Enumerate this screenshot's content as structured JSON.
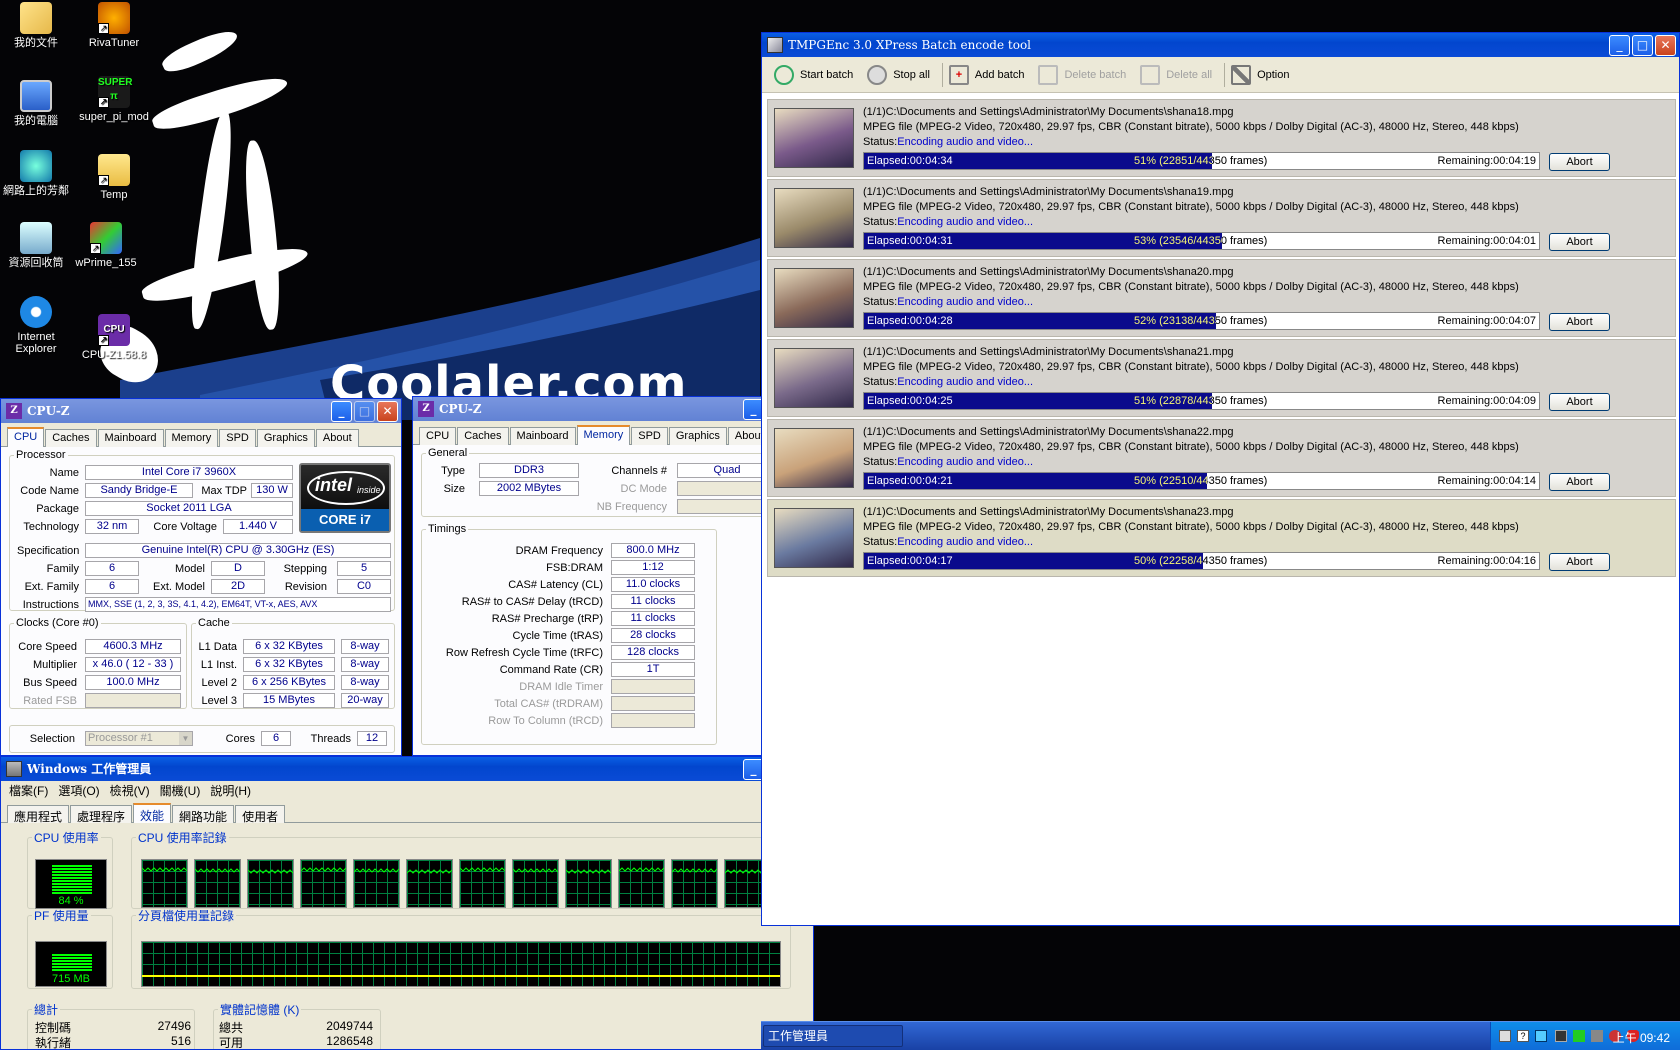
{
  "desktop": {
    "banner_text": "Coolaler.com",
    "icons": [
      {
        "label": "我的文件",
        "icon": "folder-documents-icon"
      },
      {
        "label": "RivaTuner",
        "icon": "rivatuner-icon"
      },
      {
        "label": "我的電腦",
        "icon": "computer-icon"
      },
      {
        "label": "super_pi_mod",
        "icon": "superpi-icon"
      },
      {
        "label": "網路上的芳鄰",
        "icon": "network-icon"
      },
      {
        "label": "Temp",
        "icon": "folder-icon"
      },
      {
        "label": "資源回收筒",
        "icon": "recycle-bin-icon"
      },
      {
        "label": "wPrime_155",
        "icon": "wprime-icon"
      },
      {
        "label": "Internet Explorer",
        "icon": "ie-icon"
      },
      {
        "label": "CPU-Z1.58.8",
        "icon": "cpuz-icon"
      }
    ]
  },
  "cpuz_cpu": {
    "title": "CPU-Z",
    "tabs": [
      "CPU",
      "Caches",
      "Mainboard",
      "Memory",
      "SPD",
      "Graphics",
      "About"
    ],
    "active_tab": "CPU",
    "processor_legend": "Processor",
    "name_label": "Name",
    "name": "Intel Core i7 3960X",
    "codename_label": "Code Name",
    "codename": "Sandy Bridge-E",
    "maxtdp_label": "Max TDP",
    "maxtdp": "130 W",
    "package_label": "Package",
    "package": "Socket 2011 LGA",
    "technology_label": "Technology",
    "technology": "32 nm",
    "corevoltage_label": "Core Voltage",
    "corevoltage": "1.440 V",
    "spec_label": "Specification",
    "spec": "Genuine Intel(R) CPU  @ 3.30GHz (ES)",
    "family_label": "Family",
    "family": "6",
    "model_label": "Model",
    "model": "D",
    "stepping_label": "Stepping",
    "stepping": "5",
    "extfamily_label": "Ext. Family",
    "extfamily": "6",
    "extmodel_label": "Ext. Model",
    "extmodel": "2D",
    "revision_label": "Revision",
    "revision": "C0",
    "instructions_label": "Instructions",
    "instructions": "MMX, SSE (1, 2, 3, 3S, 4.1, 4.2), EM64T, VT-x, AES, AVX",
    "logo_brand": "intel",
    "logo_inside": "inside",
    "logo_line": "CORE i7",
    "clocks_legend": "Clocks (Core #0)",
    "corespeed_label": "Core Speed",
    "corespeed": "4600.3 MHz",
    "multiplier_label": "Multiplier",
    "multiplier": "x 46.0 ( 12 - 33 )",
    "busspeed_label": "Bus Speed",
    "busspeed": "100.0 MHz",
    "ratedfsb_label": "Rated FSB",
    "ratedfsb": "",
    "cache_legend": "Cache",
    "l1d_label": "L1 Data",
    "l1d": "6 x 32 KBytes",
    "l1d_way": "8-way",
    "l1i_label": "L1 Inst.",
    "l1i": "6 x 32 KBytes",
    "l1i_way": "8-way",
    "l2_label": "Level 2",
    "l2": "6 x 256 KBytes",
    "l2_way": "8-way",
    "l3_label": "Level 3",
    "l3": "15 MBytes",
    "l3_way": "20-way",
    "selection_label": "Selection",
    "selection": "Processor #1",
    "cores_label": "Cores",
    "cores": "6",
    "threads_label": "Threads",
    "threads": "12"
  },
  "cpuz_mem": {
    "title": "CPU-Z",
    "tabs": [
      "CPU",
      "Caches",
      "Mainboard",
      "Memory",
      "SPD",
      "Graphics",
      "About"
    ],
    "active_tab": "Memory",
    "general_legend": "General",
    "type_label": "Type",
    "type": "DDR3",
    "channels_label": "Channels #",
    "channels": "Quad",
    "size_label": "Size",
    "size": "2002 MBytes",
    "dcmode_label": "DC Mode",
    "nbfreq_label": "NB Frequency",
    "timings_legend": "Timings",
    "timings": [
      {
        "label": "DRAM Frequency",
        "value": "800.0 MHz",
        "enabled": true
      },
      {
        "label": "FSB:DRAM",
        "value": "1:12",
        "enabled": true
      },
      {
        "label": "CAS# Latency (CL)",
        "value": "11.0 clocks",
        "enabled": true
      },
      {
        "label": "RAS# to CAS# Delay (tRCD)",
        "value": "11 clocks",
        "enabled": true
      },
      {
        "label": "RAS# Precharge (tRP)",
        "value": "11 clocks",
        "enabled": true
      },
      {
        "label": "Cycle Time (tRAS)",
        "value": "28 clocks",
        "enabled": true
      },
      {
        "label": "Row Refresh Cycle Time (tRFC)",
        "value": "128 clocks",
        "enabled": true
      },
      {
        "label": "Command Rate (CR)",
        "value": "1T",
        "enabled": true
      },
      {
        "label": "DRAM Idle Timer",
        "value": "",
        "enabled": false
      },
      {
        "label": "Total CAS# (tRDRAM)",
        "value": "",
        "enabled": false
      },
      {
        "label": "Row To Column (tRCD)",
        "value": "",
        "enabled": false
      }
    ]
  },
  "taskmgr": {
    "title": "Windows 工作管理員",
    "menu": [
      "檔案(F)",
      "選項(O)",
      "檢視(V)",
      "關機(U)",
      "說明(H)"
    ],
    "tabs": [
      "應用程式",
      "處理程序",
      "效能",
      "網路功能",
      "使用者"
    ],
    "active_tab": "效能",
    "cpu_usage_legend": "CPU 使用率",
    "cpu_usage": "84 %",
    "cpu_usage_fraction": 0.84,
    "cpu_history_legend": "CPU 使用率記錄",
    "pf_usage_legend": "PF 使用量",
    "pf_usage": "715 MB",
    "pf_history_legend": "分頁檔使用量記錄",
    "totals_legend": "總計",
    "totals": [
      {
        "label": "控制碼",
        "value": "27496"
      },
      {
        "label": "執行緒",
        "value": "516"
      }
    ],
    "physical_legend": "實體記憶體 (K)",
    "physical": [
      {
        "label": "總共",
        "value": "2049744"
      },
      {
        "label": "可用",
        "value": "1286548"
      }
    ],
    "colors": {
      "graph_line": "#00ff00",
      "grid": "#008040",
      "pf_line": "#ffff00"
    }
  },
  "tmpgenc": {
    "title": "TMPGEnc 3.0 XPress Batch encode tool",
    "toolbar": [
      {
        "label": "Start batch",
        "icon": "play-icon",
        "enabled": true
      },
      {
        "label": "Stop all",
        "icon": "stop-icon",
        "enabled": true
      },
      {
        "label": "Add batch",
        "icon": "add-icon",
        "enabled": true
      },
      {
        "label": "Delete batch",
        "icon": "delete-icon",
        "enabled": false
      },
      {
        "label": "Delete all",
        "icon": "trash-icon",
        "enabled": false
      },
      {
        "label": "Option",
        "icon": "wrench-icon",
        "enabled": true
      }
    ],
    "jobs": [
      {
        "path": "(1/1)C:\\Documents and Settings\\Administrator\\My Documents\\shana18.mpg",
        "info": "MPEG file (MPEG-2 Video, 720x480, 29.97 fps, CBR (Constant bitrate), 5000 kbps / Dolby Digital (AC-3), 48000 Hz, Stereo, 448 kbps)",
        "status_label": "Status:",
        "status": "Encoding audio and video...",
        "elapsed": "Elapsed:00:04:34",
        "progress": "51% (22851/44350  frames)",
        "remaining": "Remaining:00:04:19",
        "fraction": 0.515,
        "abort": "Abort"
      },
      {
        "path": "(1/1)C:\\Documents and Settings\\Administrator\\My Documents\\shana19.mpg",
        "info": "MPEG file (MPEG-2 Video, 720x480, 29.97 fps, CBR (Constant bitrate), 5000 kbps / Dolby Digital (AC-3), 48000 Hz, Stereo, 448 kbps)",
        "status_label": "Status:",
        "status": "Encoding audio and video...",
        "elapsed": "Elapsed:00:04:31",
        "progress": "53% (23546/44350  frames)",
        "remaining": "Remaining:00:04:01",
        "fraction": 0.531,
        "abort": "Abort"
      },
      {
        "path": "(1/1)C:\\Documents and Settings\\Administrator\\My Documents\\shana20.mpg",
        "info": "MPEG file (MPEG-2 Video, 720x480, 29.97 fps, CBR (Constant bitrate), 5000 kbps / Dolby Digital (AC-3), 48000 Hz, Stereo, 448 kbps)",
        "status_label": "Status:",
        "status": "Encoding audio and video...",
        "elapsed": "Elapsed:00:04:28",
        "progress": "52% (23138/44350  frames)",
        "remaining": "Remaining:00:04:07",
        "fraction": 0.522,
        "abort": "Abort"
      },
      {
        "path": "(1/1)C:\\Documents and Settings\\Administrator\\My Documents\\shana21.mpg",
        "info": "MPEG file (MPEG-2 Video, 720x480, 29.97 fps, CBR (Constant bitrate), 5000 kbps / Dolby Digital (AC-3), 48000 Hz, Stereo, 448 kbps)",
        "status_label": "Status:",
        "status": "Encoding audio and video...",
        "elapsed": "Elapsed:00:04:25",
        "progress": "51% (22878/44350  frames)",
        "remaining": "Remaining:00:04:09",
        "fraction": 0.516,
        "abort": "Abort"
      },
      {
        "path": "(1/1)C:\\Documents and Settings\\Administrator\\My Documents\\shana22.mpg",
        "info": "MPEG file (MPEG-2 Video, 720x480, 29.97 fps, CBR (Constant bitrate), 5000 kbps / Dolby Digital (AC-3), 48000 Hz, Stereo, 448 kbps)",
        "status_label": "Status:",
        "status": "Encoding audio and video...",
        "elapsed": "Elapsed:00:04:21",
        "progress": "50% (22510/44350  frames)",
        "remaining": "Remaining:00:04:14",
        "fraction": 0.508,
        "abort": "Abort"
      },
      {
        "path": "(1/1)C:\\Documents and Settings\\Administrator\\My Documents\\shana23.mpg",
        "info": "MPEG file (MPEG-2 Video, 720x480, 29.97 fps, CBR (Constant bitrate), 5000 kbps / Dolby Digital (AC-3), 48000 Hz, Stereo, 448 kbps)",
        "status_label": "Status:",
        "status": "Encoding audio and video...",
        "elapsed": "Elapsed:00:04:17",
        "progress": "50% (22258/44350  frames)",
        "remaining": "Remaining:00:04:16",
        "fraction": 0.502,
        "abort": "Abort"
      }
    ]
  },
  "taskbar": {
    "item": "工作管理員",
    "clock": "上午 09:42",
    "tray_icons": [
      "keyboard-icon",
      "help-icon",
      "network-icon",
      "monitor-icon",
      "cpu-icon",
      "speaker-icon",
      "security-icon",
      "shield-icon",
      "sync-icon"
    ]
  }
}
